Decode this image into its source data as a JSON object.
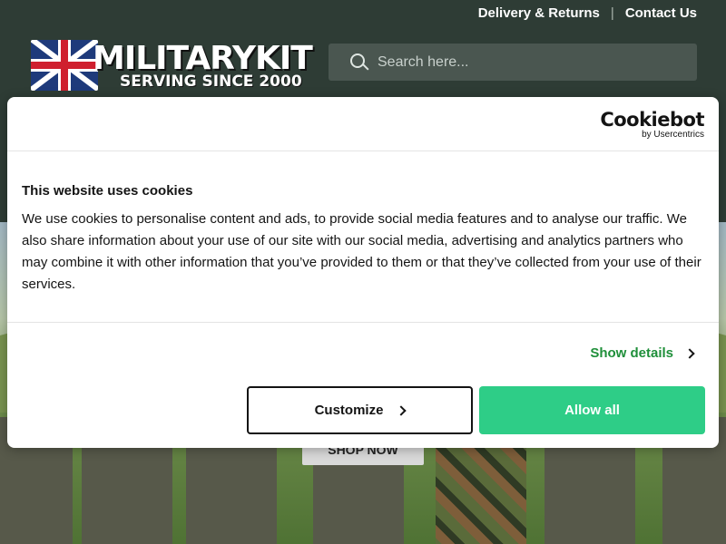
{
  "header": {
    "links": {
      "delivery": "Delivery & Returns",
      "separator": "|",
      "contact": "Contact Us"
    },
    "logo": {
      "brand": "MILITARYKIT",
      "tagline": "SERVING SINCE 2000"
    },
    "search": {
      "placeholder": "Search here..."
    }
  },
  "hero": {
    "shop_label": "SHOP NOW"
  },
  "cookie_dialog": {
    "provider_name": "Cookiebot",
    "provider_by": "by Usercentrics",
    "title": "This website uses cookies",
    "body": "We use cookies to personalise content and ads, to provide social media features and to analyse our traffic. We also share information about your use of our site with our social media, advertising and analytics partners who may combine it with other information that you’ve provided to them or that they’ve collected from your use of their services.",
    "show_details": "Show details",
    "customize_label": "Customize",
    "allow_label": "Allow all"
  },
  "colors": {
    "header_bg": "#2e3c35",
    "accent_green": "#2ecd87",
    "details_green": "#1f8f3a"
  }
}
